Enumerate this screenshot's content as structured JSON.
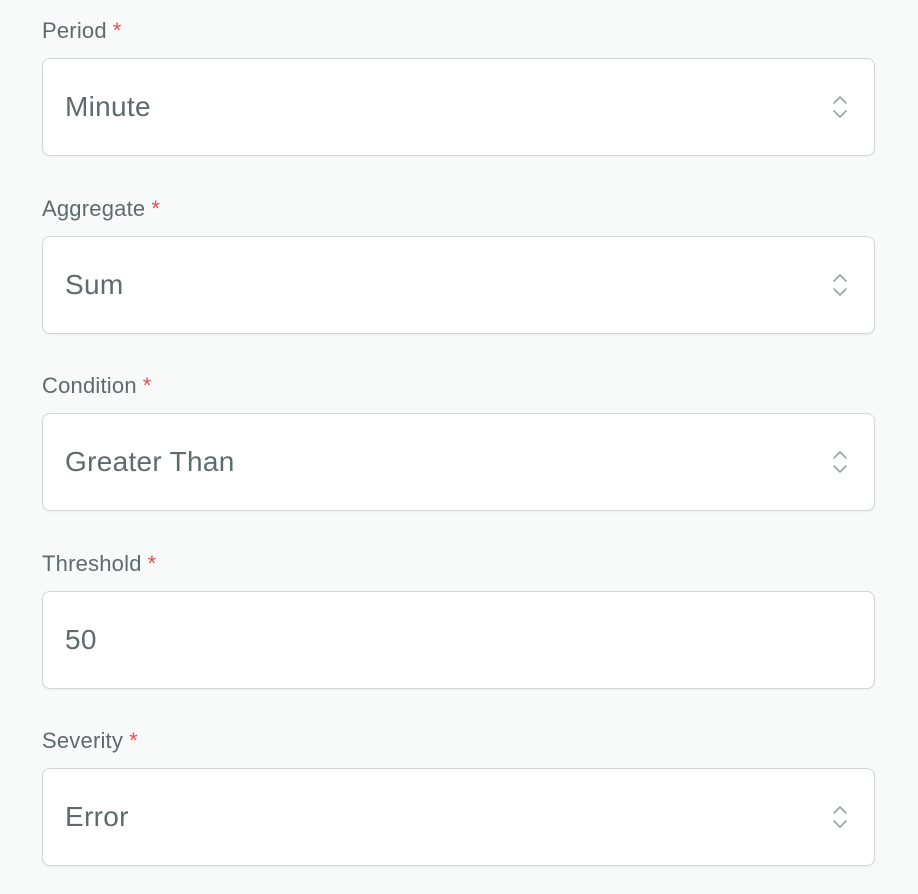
{
  "required_marker": "*",
  "icons": {
    "select": "chevron-up-down-icon"
  },
  "colors": {
    "required": "#e05252",
    "text": "#5f6a6b",
    "border": "#d3d6d7"
  },
  "fields": {
    "period": {
      "label": "Period",
      "value": "Minute"
    },
    "aggregate": {
      "label": "Aggregate",
      "value": "Sum"
    },
    "condition": {
      "label": "Condition",
      "value": "Greater Than"
    },
    "threshold": {
      "label": "Threshold",
      "value": "50"
    },
    "severity": {
      "label": "Severity",
      "value": "Error"
    }
  }
}
